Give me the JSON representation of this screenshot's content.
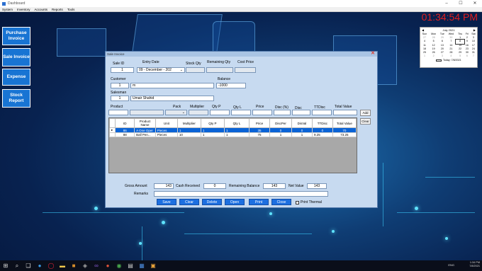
{
  "window": {
    "title": "Dashboard"
  },
  "menu": [
    "System",
    "Inventory",
    "Accounts",
    "Reports",
    "Tools"
  ],
  "nav": [
    {
      "label": "Purchase Invoice",
      "name": "purchase-invoice-button"
    },
    {
      "label": "Sale Invoice",
      "name": "sale-invoice-button"
    },
    {
      "label": "Expense",
      "name": "expense-button"
    },
    {
      "label": "Stock Report",
      "name": "stock-report-button"
    }
  ],
  "clock": "01:34:54 PM",
  "calendar": {
    "month": "July 2021",
    "days": [
      "Sun",
      "Mon",
      "Tue",
      "Wed",
      "Thu",
      "Fri",
      "Sat"
    ],
    "weeks": [
      [
        "27",
        "28",
        "29",
        "30",
        "1",
        "2",
        "3"
      ],
      [
        "4",
        "5",
        "6",
        "7",
        "8",
        "9",
        "10"
      ],
      [
        "11",
        "12",
        "13",
        "14",
        "15",
        "16",
        "17"
      ],
      [
        "18",
        "19",
        "20",
        "21",
        "22",
        "23",
        "24"
      ],
      [
        "25",
        "26",
        "27",
        "28",
        "29",
        "30",
        "31"
      ],
      [
        "1",
        "2",
        "3",
        "4",
        "5",
        "6",
        "7"
      ]
    ],
    "today": "Today: 7/8/2021"
  },
  "dialog": {
    "title": "Sale Invoice",
    "labels": {
      "sale_id": "Sale ID",
      "entry_date": "Entry Date",
      "stock_qty": "Stock Qty",
      "remaining_qty": "Remaining Qty",
      "cost_price": "Cost Price",
      "customer": "Customer",
      "balance": "Balance",
      "salesman": "Salesman",
      "product": "Product",
      "pack": "Pack",
      "multiplier": "Multiplier",
      "qty_p": "Qty P",
      "qty_l": "Qty L",
      "price": "Price",
      "disc_pct": "Disc (%)",
      "disc": "Disc",
      "ttdisc": "TTDisc",
      "total_value": "Total Value"
    },
    "values": {
      "sale_id": "1",
      "entry_date": "09 - December - 202",
      "customer_id": "1",
      "customer_name": "m",
      "balance": "-1000",
      "salesman_id": "1",
      "salesman_name": "Umair Shahid"
    },
    "add_label": "Add",
    "clear_side_label": "Clear",
    "grid": {
      "columns": [
        "ID",
        "Product Name",
        "Unit",
        "Multiplier",
        "Qty P",
        "Qty L",
        "Price",
        "DiscPer",
        "DisVal",
        "TTDisc",
        "Total Value"
      ],
      "rows": [
        {
          "id": "86",
          "name": "A One Oper",
          "unit": "Pieces",
          "mult": "1",
          "qp": "1",
          "ql": "1",
          "price": "35",
          "dp": "0",
          "dv": "0",
          "tt": "0",
          "total": "70"
        },
        {
          "id": "88",
          "name": "Ball Pen...",
          "unit": "Pieces",
          "mult": "10",
          "qp": "1",
          "ql": "1",
          "price": "75",
          "dp": "1",
          "dv": "1",
          "tt": "9.25",
          "total": "73.25"
        }
      ]
    },
    "footer": {
      "gross_label": "Gross Amount",
      "gross": "143",
      "cash_label": "Cash Received",
      "cash": "0",
      "rem_label": "Remaining Balance",
      "rem": "143",
      "net_label": "Net Value",
      "net": "143",
      "remarks_label": "Remarks",
      "remarks": ""
    },
    "buttons": [
      "Save",
      "Clear",
      "Delete",
      "Open",
      "Print",
      "Close"
    ],
    "print_thermal": "Print Thermal"
  },
  "taskbar": {
    "lang": "ENG",
    "time": "1:34 PM",
    "date": "7/8/2021"
  },
  "colors": {
    "accent": "#1d6fe0",
    "clock": "#e21f1f",
    "nav": "#1874d3"
  }
}
